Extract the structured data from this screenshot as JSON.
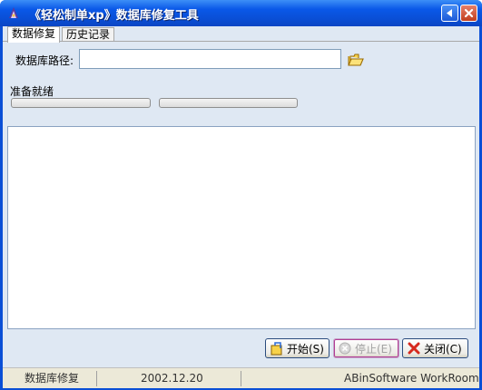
{
  "window": {
    "title": "《轻松制单xp》数据库修复工具"
  },
  "tabs": [
    {
      "label": "数据修复",
      "active": true
    },
    {
      "label": "历史记录",
      "active": false
    }
  ],
  "form": {
    "path_label": "数据库路径:",
    "path_value": "",
    "status_text": "准备就绪"
  },
  "progress": [
    {
      "value": 0
    },
    {
      "value": 0
    }
  ],
  "buttons": {
    "start_label": "开始(S)",
    "stop_label": "停止(E)",
    "close_label": "关闭(C)"
  },
  "statusbar": {
    "name": "数据库修复",
    "date": "2002.12.20",
    "company": "ABinSoftware WorkRoom"
  },
  "colors": {
    "titlebar": "#0a4fd6",
    "client": "#dfe8f3",
    "statusbar": "#ece9d8"
  }
}
